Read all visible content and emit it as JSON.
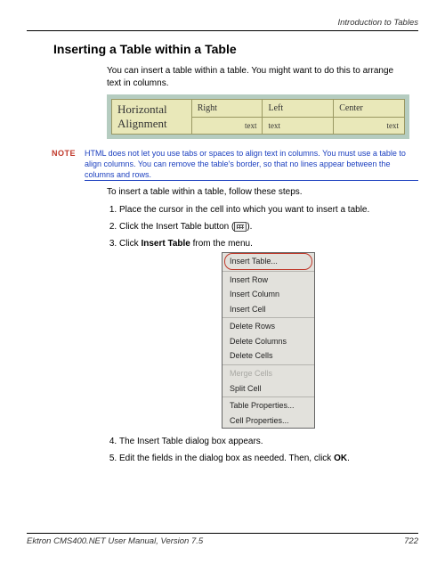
{
  "header": {
    "doc_title": "Introduction to Tables"
  },
  "heading": "Inserting a Table within a Table",
  "intro": "You can insert a table within a table. You might want to do this to arrange text in columns.",
  "sample": {
    "row_label": "Horizontal Alignment",
    "c1": "Right",
    "c2": "Left",
    "c3": "Center",
    "s1": "text",
    "s2": "text",
    "s3": "text"
  },
  "note": {
    "label": "NOTE",
    "text": "HTML does not let you use tabs or spaces to align text in columns. You must use a table to align columns. You can remove the table's border, so that no lines appear between the columns and rows."
  },
  "lead_in": "To insert a table within a table, follow these steps.",
  "steps": {
    "s1": "Place the cursor in the cell into which you want to insert a table.",
    "s2a": "Click the Insert Table button (",
    "s2b": ").",
    "s3a": "Click ",
    "s3b": "Insert Table",
    "s3c": " from the menu.",
    "s4": "The Insert Table dialog box appears.",
    "s5a": "Edit the fields in the dialog box as needed. Then, click ",
    "s5b": "OK",
    "s5c": "."
  },
  "menu": {
    "m1": "Insert Table...",
    "m2": "Insert Row",
    "m3": "Insert Column",
    "m4": "Insert Cell",
    "m5": "Delete Rows",
    "m6": "Delete Columns",
    "m7": "Delete Cells",
    "m8": "Merge Cells",
    "m9": "Split Cell",
    "m10": "Table Properties...",
    "m11": "Cell Properties..."
  },
  "footer": {
    "left": "Ektron CMS400.NET User Manual, Version 7.5",
    "right": "722"
  }
}
